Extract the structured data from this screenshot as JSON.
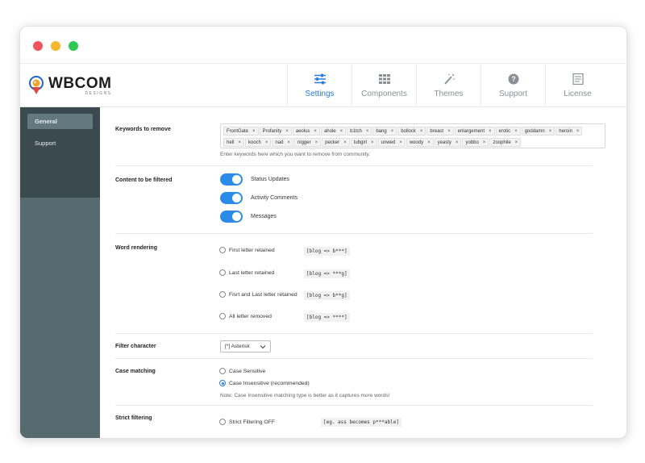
{
  "window": {
    "controls": [
      "close",
      "minimize",
      "maximize"
    ]
  },
  "brand": {
    "name": "WBCOM",
    "sub": "DESIGNS"
  },
  "tabs": [
    {
      "label": "Settings",
      "icon": "sliders-icon",
      "active": true
    },
    {
      "label": "Components",
      "icon": "grid-icon",
      "active": false
    },
    {
      "label": "Themes",
      "icon": "magic-wand-icon",
      "active": false
    },
    {
      "label": "Support",
      "icon": "question-icon",
      "active": false
    },
    {
      "label": "License",
      "icon": "license-icon",
      "active": false
    }
  ],
  "sidebar": {
    "items": [
      {
        "label": "General",
        "active": true
      },
      {
        "label": "Support",
        "active": false
      }
    ]
  },
  "keywords": {
    "label": "Keywords to remove",
    "tags": [
      "FrontGate",
      "Profanity",
      "aeolus",
      "ahole",
      "b1tch",
      "bang",
      "bollock",
      "breast",
      "enlargement",
      "erotic",
      "goddamn",
      "heroin",
      "hell",
      "kooch",
      "nad",
      "nigger",
      "pecker",
      "tubgirl",
      "unwed",
      "woody",
      "yeasty",
      "yobbo",
      "zoophile"
    ],
    "remove_symbol": "×",
    "hint": "Enter keywords here which you want to remove from community."
  },
  "content_filter": {
    "label": "Content to be filtered",
    "options": [
      {
        "label": "Status Updates",
        "enabled": true
      },
      {
        "label": "Activity Comments",
        "enabled": true
      },
      {
        "label": "Messages",
        "enabled": true
      }
    ]
  },
  "word_rendering": {
    "label": "Word rendering",
    "options": [
      {
        "label": "First letter retained",
        "example": "[blog => b***]"
      },
      {
        "label": "Last letter retained",
        "example": "[blog => ***g]"
      },
      {
        "label": "Fisrt and Last letter retained",
        "example": "[blog => b**g]"
      },
      {
        "label": "All letter removed",
        "example": "[blog => ****]"
      }
    ]
  },
  "filter_character": {
    "label": "Filter character",
    "selected": "[*] Asterisk"
  },
  "case_matching": {
    "label": "Case matching",
    "options": [
      {
        "label": "Case Sensitive",
        "checked": false
      },
      {
        "label": "Case Insensitive (recommended)",
        "checked": true
      }
    ],
    "note": "Note: Case Insensitive matching type is better as it captures more words!"
  },
  "strict_filtering": {
    "label": "Strict filtering",
    "option": "Strict Filtering OFF",
    "example": "[eg. ass becomes p***able]"
  },
  "colors": {
    "accent": "#2a8be8",
    "sidebar_dark": "#3a4a4f",
    "sidebar": "#566a6f"
  }
}
